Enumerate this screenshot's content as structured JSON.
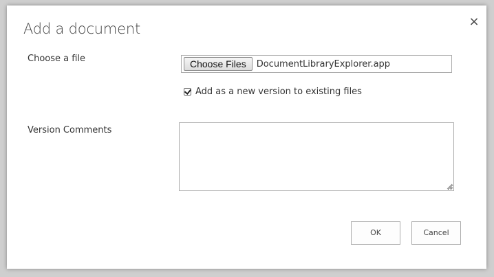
{
  "dialog": {
    "title": "Add a document",
    "close_glyph": "×"
  },
  "file_field": {
    "label": "Choose a file",
    "button_label": "Choose Files",
    "selected_file": "DocumentLibraryExplorer.app"
  },
  "version_checkbox": {
    "label": "Add as a new version to existing files",
    "checked": true
  },
  "comments": {
    "label": "Version Comments",
    "value": ""
  },
  "footer": {
    "ok_label": "OK",
    "cancel_label": "Cancel"
  }
}
